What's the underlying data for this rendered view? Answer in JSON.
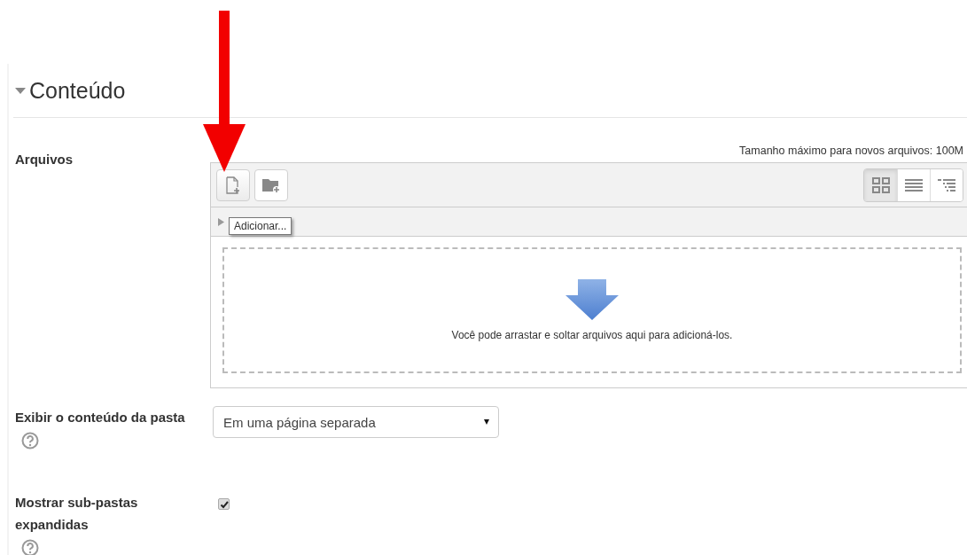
{
  "section": {
    "title": "Conteúdo",
    "expanded": true
  },
  "files": {
    "label": "Arquivos",
    "max_size": "Tamanho máximo para novos arquivos: 100M",
    "tooltip": "Adicionar...",
    "views": [
      {
        "kind": "icons",
        "selected": true
      },
      {
        "kind": "list",
        "selected": false
      },
      {
        "kind": "tree",
        "selected": false
      }
    ],
    "drop_text": "Você pode arrastar e soltar arquivos aqui para adicioná-los."
  },
  "display": {
    "label": "Exibir o conteúdo da pasta",
    "value": "Em uma página separada"
  },
  "subfolders": {
    "label": "Mostrar sub-pastas expandidas",
    "checked": true
  }
}
